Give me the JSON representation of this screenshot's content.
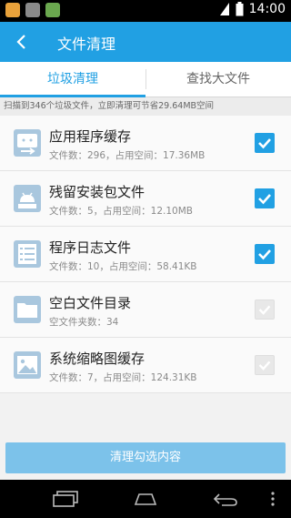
{
  "status_bar": {
    "time": "14:00"
  },
  "header": {
    "title": "文件清理"
  },
  "tabs": [
    {
      "label": "垃圾清理",
      "active": true
    },
    {
      "label": "查找大文件",
      "active": false
    }
  ],
  "scan_info": "扫描到346个垃圾文件，立即清理可节省29.64MB空间",
  "items": [
    {
      "name": "应用程序缓存",
      "detail": "文件数：296，占用空间：17.36MB",
      "checked": true,
      "icon": "app-cache-icon"
    },
    {
      "name": "残留安装包文件",
      "detail": "文件数：5，占用空间：12.10MB",
      "checked": true,
      "icon": "apk-package-icon"
    },
    {
      "name": "程序日志文件",
      "detail": "文件数：10，占用空间：58.41KB",
      "checked": true,
      "icon": "log-file-icon"
    },
    {
      "name": "空白文件目录",
      "detail": "空文件夹数：34",
      "checked": false,
      "icon": "empty-folder-icon"
    },
    {
      "name": "系统缩略图缓存",
      "detail": "文件数：7，占用空间：124.31KB",
      "checked": false,
      "icon": "thumbnail-image-icon"
    }
  ],
  "action_button": "清理勾选内容",
  "colors": {
    "accent": "#21a0e3",
    "button": "#7cc2ea"
  }
}
